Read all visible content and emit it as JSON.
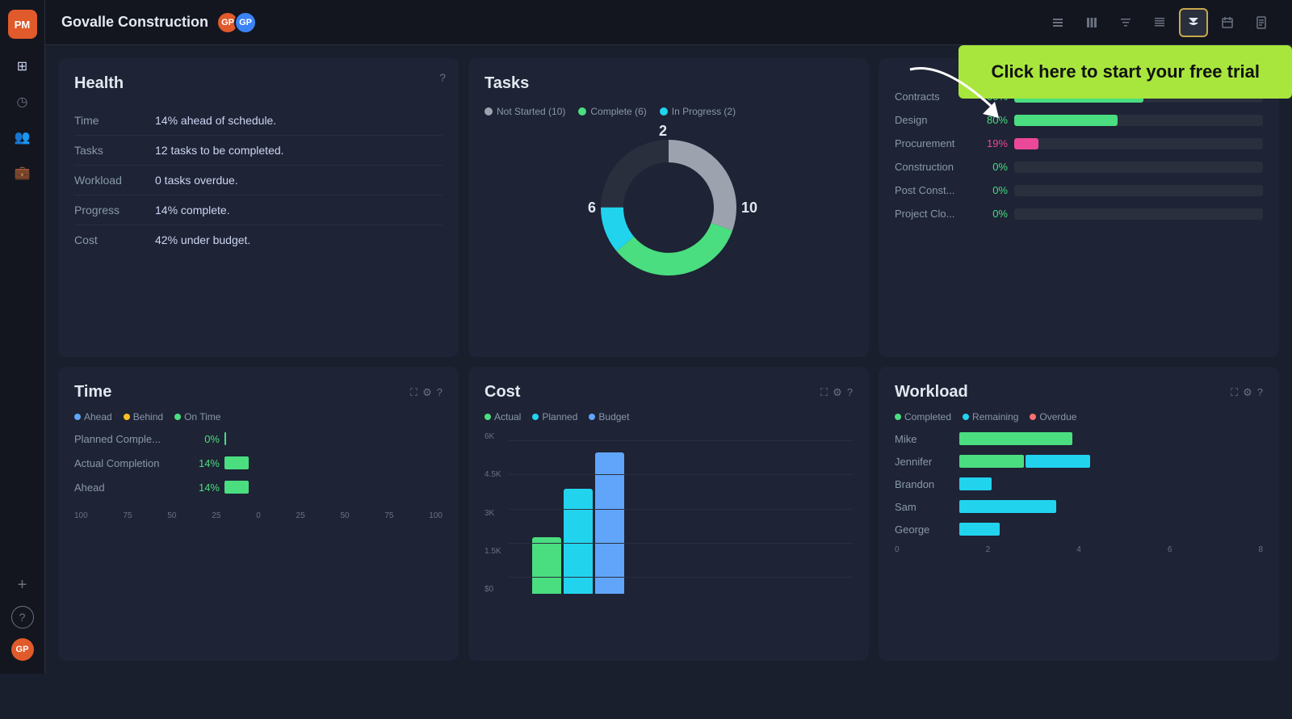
{
  "app": {
    "logo": "PM",
    "title": "Govalle Construction"
  },
  "header": {
    "title": "Govalle Construction",
    "toolbar_icons": [
      "list-icon",
      "columns-icon",
      "filter-icon",
      "table-icon",
      "chart-icon",
      "calendar-icon",
      "doc-icon"
    ]
  },
  "trial_banner": "Click here to start your free trial",
  "health": {
    "title": "Health",
    "rows": [
      {
        "label": "Time",
        "value": "14% ahead of schedule."
      },
      {
        "label": "Tasks",
        "value": "12 tasks to be completed."
      },
      {
        "label": "Workload",
        "value": "0 tasks overdue."
      },
      {
        "label": "Progress",
        "value": "14% complete."
      },
      {
        "label": "Cost",
        "value": "42% under budget."
      }
    ]
  },
  "tasks": {
    "title": "Tasks",
    "legend": [
      {
        "label": "Not Started (10)",
        "color": "#9ca3af"
      },
      {
        "label": "Complete (6)",
        "color": "#4ade80"
      },
      {
        "label": "In Progress (2)",
        "color": "#22d3ee"
      }
    ],
    "donut": {
      "not_started": 10,
      "complete": 6,
      "in_progress": 2,
      "total": 18,
      "label_left": "6",
      "label_top": "2",
      "label_right": "10"
    },
    "progress_bars": [
      {
        "label": "Contracts",
        "pct": 100,
        "color": "#4ade80",
        "pct_label": "100%"
      },
      {
        "label": "Design",
        "pct": 80,
        "color": "#4ade80",
        "pct_label": "80%"
      },
      {
        "label": "Procurement",
        "pct": 19,
        "color": "#ec4899",
        "pct_label": "19%"
      },
      {
        "label": "Construction",
        "pct": 0,
        "color": "#4ade80",
        "pct_label": "0%"
      },
      {
        "label": "Post Const...",
        "pct": 0,
        "color": "#4ade80",
        "pct_label": "0%"
      },
      {
        "label": "Project Clo...",
        "pct": 0,
        "color": "#4ade80",
        "pct_label": "0%"
      }
    ]
  },
  "time": {
    "title": "Time",
    "legend": [
      {
        "label": "Ahead",
        "color": "#60a5fa"
      },
      {
        "label": "Behind",
        "color": "#fbbf24"
      },
      {
        "label": "On Time",
        "color": "#4ade80"
      }
    ],
    "rows": [
      {
        "label": "Planned Comple...",
        "pct_label": "0%",
        "pct": 0
      },
      {
        "label": "Actual Completion",
        "pct_label": "14%",
        "pct": 14
      },
      {
        "label": "Ahead",
        "pct_label": "14%",
        "pct": 14
      }
    ],
    "x_axis": [
      "100",
      "75",
      "50",
      "25",
      "0",
      "25",
      "50",
      "75",
      "100"
    ]
  },
  "cost": {
    "title": "Cost",
    "legend": [
      {
        "label": "Actual",
        "color": "#4ade80"
      },
      {
        "label": "Planned",
        "color": "#22d3ee"
      },
      {
        "label": "Budget",
        "color": "#60a5fa"
      }
    ],
    "y_labels": [
      "6K",
      "4.5K",
      "3K",
      "1.5K",
      "$0"
    ],
    "bars": [
      {
        "actual": 40,
        "planned": 75,
        "budget": 100
      }
    ]
  },
  "workload": {
    "title": "Workload",
    "legend": [
      {
        "label": "Completed",
        "color": "#4ade80"
      },
      {
        "label": "Remaining",
        "color": "#22d3ee"
      },
      {
        "label": "Overdue",
        "color": "#f87171"
      }
    ],
    "rows": [
      {
        "label": "Mike",
        "completed": 140,
        "remaining": 0,
        "overdue": 0
      },
      {
        "label": "Jennifer",
        "completed": 80,
        "remaining": 80,
        "overdue": 0
      },
      {
        "label": "Brandon",
        "completed": 0,
        "remaining": 40,
        "overdue": 0
      },
      {
        "label": "Sam",
        "completed": 0,
        "remaining": 120,
        "overdue": 0
      },
      {
        "label": "George",
        "completed": 0,
        "remaining": 50,
        "overdue": 0
      }
    ],
    "x_axis": [
      "0",
      "2",
      "4",
      "6",
      "8"
    ]
  },
  "sidebar": {
    "items": [
      {
        "icon": "⊞",
        "name": "dashboard"
      },
      {
        "icon": "◷",
        "name": "history"
      },
      {
        "icon": "👥",
        "name": "team"
      },
      {
        "icon": "💼",
        "name": "portfolio"
      }
    ],
    "bottom_items": [
      {
        "icon": "+",
        "name": "add"
      },
      {
        "icon": "?",
        "name": "help"
      },
      {
        "icon": "👤",
        "name": "profile"
      }
    ]
  }
}
